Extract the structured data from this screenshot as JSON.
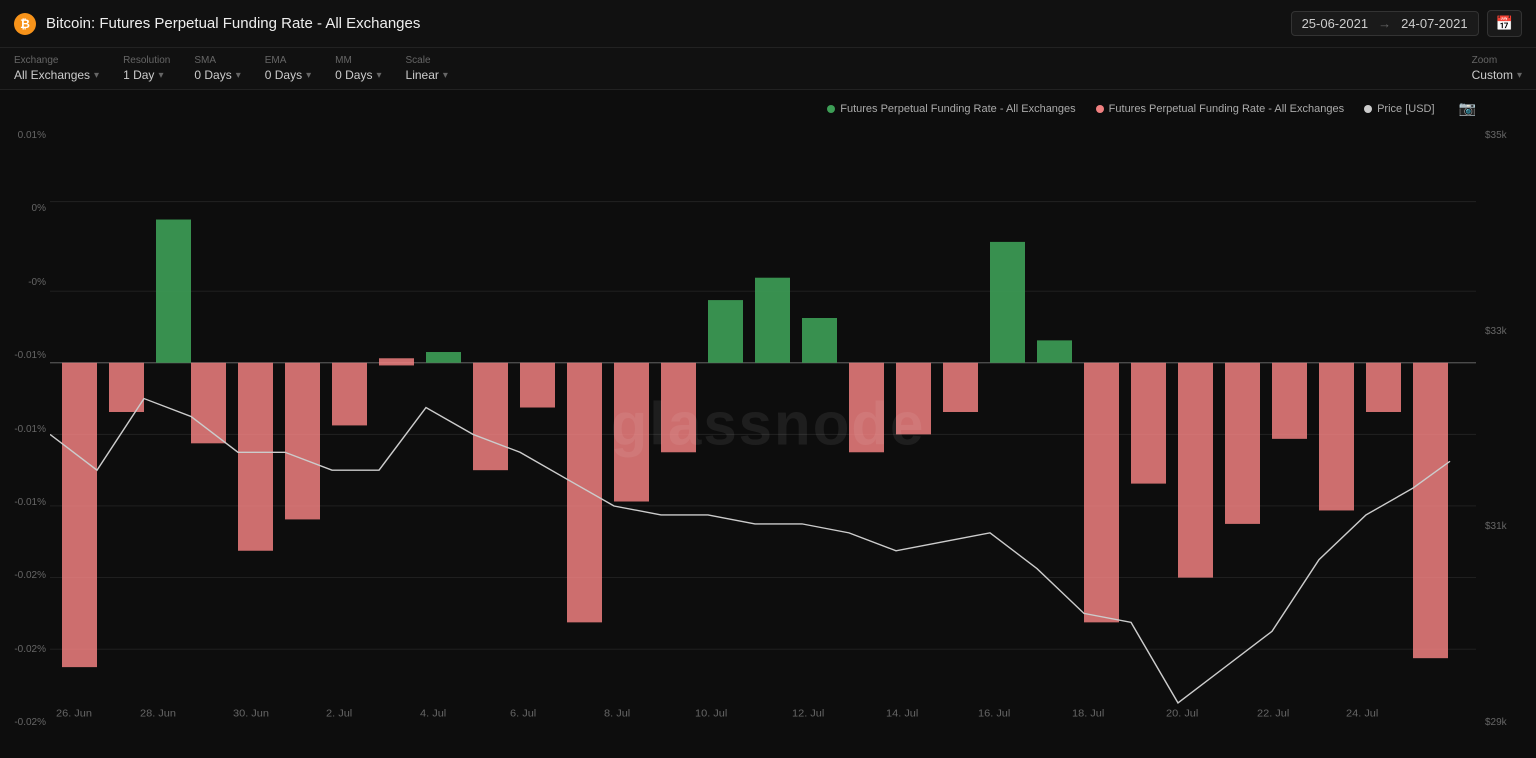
{
  "header": {
    "title": "Bitcoin: Futures Perpetual Funding Rate - All Exchanges",
    "btc_symbol": "₿",
    "date_from": "25-06-2021",
    "date_to": "24-07-2021",
    "date_arrow": "→"
  },
  "toolbar": {
    "exchange_label": "Exchange",
    "exchange_value": "All Exchanges",
    "resolution_label": "Resolution",
    "resolution_value": "1 Day",
    "sma_label": "SMA",
    "sma_value": "0 Days",
    "ema_label": "EMA",
    "ema_value": "0 Days",
    "mm_label": "MM",
    "mm_value": "0 Days",
    "scale_label": "Scale",
    "scale_value": "Linear",
    "zoom_label": "Zoom",
    "zoom_value": "Custom"
  },
  "legend": {
    "item1": "Futures Perpetual Funding Rate - All Exchanges",
    "item2": "Futures Perpetual Funding Rate - All Exchanges",
    "item3": "Price [USD]"
  },
  "chart": {
    "watermark": "glassnode",
    "y_axis_left": [
      "0.01%",
      "0%",
      "-0%",
      "-0.01%",
      "-0.01%",
      "-0.01%",
      "-0.02%",
      "-0.02%",
      "-0.02%"
    ],
    "y_axis_right": [
      "$35k",
      "$33k",
      "$31k",
      "$29k"
    ],
    "x_axis": [
      "26. Jun",
      "28. Jun",
      "30. Jun",
      "2. Jul",
      "4. Jul",
      "6. Jul",
      "8. Jul",
      "10. Jul",
      "12. Jul",
      "14. Jul",
      "16. Jul",
      "18. Jul",
      "20. Jul",
      "22. Jul",
      "24. Jul"
    ]
  }
}
